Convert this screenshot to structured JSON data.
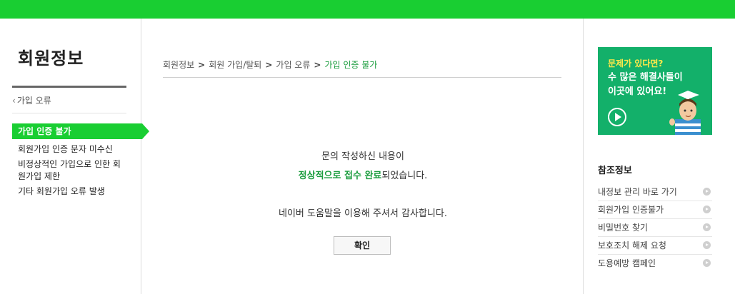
{
  "colors": {
    "brand": "#19ce32",
    "highlight": "#1a9c3d"
  },
  "sidebar": {
    "title": "회원정보",
    "back_label": "가입 오류",
    "items": [
      {
        "label": "가입 인증 불가",
        "active": true
      },
      {
        "label": "회원가입 인증 문자 미수신"
      },
      {
        "label": "비정상적인 가입으로 인한 회원가입 제한"
      },
      {
        "label": "기타 회원가입 오류 발생"
      }
    ]
  },
  "breadcrumb": {
    "items": [
      "회원정보",
      "회원 가입/탈퇴",
      "가입 오류",
      "가입 인증 불가"
    ],
    "separator": ">"
  },
  "message": {
    "line1": "문의 작성하신 내용이",
    "line2_highlight": "정상적으로 접수 완료",
    "line2_rest": "되었습니다.",
    "line3": "네이버 도움말을 이용해 주셔서 감사합니다."
  },
  "confirm_label": "확인",
  "banner": {
    "line1": "문제가 있다면?",
    "line2": "수 많은 해결사들이 이곳에 있어요!",
    "icons": [
      "play-icon",
      "graduate-character"
    ]
  },
  "reference": {
    "title": "참조정보",
    "items": [
      "내정보 관리 바로 가기",
      "회원가입 인증불가",
      "비밀번호 찾기",
      "보호조치 해제 요청",
      "도용예방 캠페인"
    ]
  }
}
